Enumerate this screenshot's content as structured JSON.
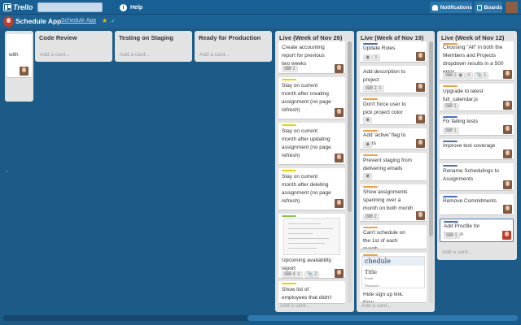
{
  "header": {
    "logo": "Trello",
    "help_label": "Help",
    "notifications_label": "Notifications",
    "boards_label": "Boards"
  },
  "board": {
    "name": "Schedule App",
    "org": "Schedule App"
  },
  "colors": {
    "header_bg": "#185f93",
    "board_bg": "#1c5a87",
    "list_bg": "#e3e3e3",
    "label_green": "#8bc34a",
    "label_yellow": "#e6d600",
    "label_orange": "#f0a040",
    "label_blue": "#4a6fbf",
    "label_red": "#d04040"
  },
  "lists": [
    {
      "title": "",
      "cards": [
        {
          "text": "with"
        }
      ]
    },
    {
      "title": "Code Review",
      "add": "Add a card..."
    },
    {
      "title": "Testing on Staging",
      "add": "Add a card..."
    },
    {
      "title": "Ready for Production",
      "add": "Add a card..."
    },
    {
      "title": "Live (Week of Nov 26)",
      "add": "Add a card...",
      "cards": [
        {
          "text": "Create accounting report for previous two weeks",
          "badges": [
            "1"
          ]
        },
        {
          "text": "Stay on current month after creating assignment (no page refresh)",
          "label": "yellow"
        },
        {
          "text": "Stay on current month after updating assignment (no page refresh)",
          "label": "yellow"
        },
        {
          "text": "Stay on current month after deleting assignment (no page refresh)",
          "label": "yellow"
        },
        {
          "text": "Upcoming availability report",
          "label": "green",
          "badges": [
            "4",
            "2"
          ]
        },
        {
          "text": "Show list of employees that didn't have full",
          "label": "yellow"
        }
      ]
    },
    {
      "title": "Live (Week of Nov 19)",
      "add": "Add a card...",
      "cards": [
        {
          "text": "Update Roles",
          "label": "blue"
        },
        {
          "text": "Add description to project",
          "badges": [
            "1"
          ]
        },
        {
          "text": "Don't force user to pick project color",
          "label": "orange"
        },
        {
          "text": "Add 'active' flag to users",
          "label": "orange"
        },
        {
          "text": "Prevent staging from delivering emails",
          "label": "orange"
        },
        {
          "text": "Show assignments spanning over a month on both month pages",
          "label": "orange",
          "badges": [
            "2"
          ]
        },
        {
          "text": "Can't schedule on the 1st of each month",
          "label": "orange"
        },
        {
          "text": "Hide sign up link. New",
          "label": "orange"
        }
      ],
      "image_card": {
        "title": "chedule",
        "heading": "Title",
        "field1": "Email",
        "field2": "Password"
      }
    },
    {
      "title": "Live (Week of Nov 12)",
      "add": "Add a card...",
      "cards": [
        {
          "text": "Choosing \"All\" in both the Members and Projects dropdown results in a 500 error",
          "label": "orange",
          "badges": [
            "2",
            "1"
          ]
        },
        {
          "text": "Upgrade to latest full_calendar.js",
          "label": "orange",
          "badges": [
            "1"
          ]
        },
        {
          "text": "Fix failing tests",
          "label": "blue",
          "badges": [
            "1"
          ]
        },
        {
          "text": "Improve test coverage",
          "label": "blue"
        },
        {
          "text": "Rename Schedulings to Assignments",
          "label": "blue"
        },
        {
          "text": "Remove Commitments",
          "label": "blue"
        },
        {
          "text": "Add Procfile for foreman",
          "label": "blue",
          "badges": [
            "1"
          ]
        }
      ]
    }
  ]
}
